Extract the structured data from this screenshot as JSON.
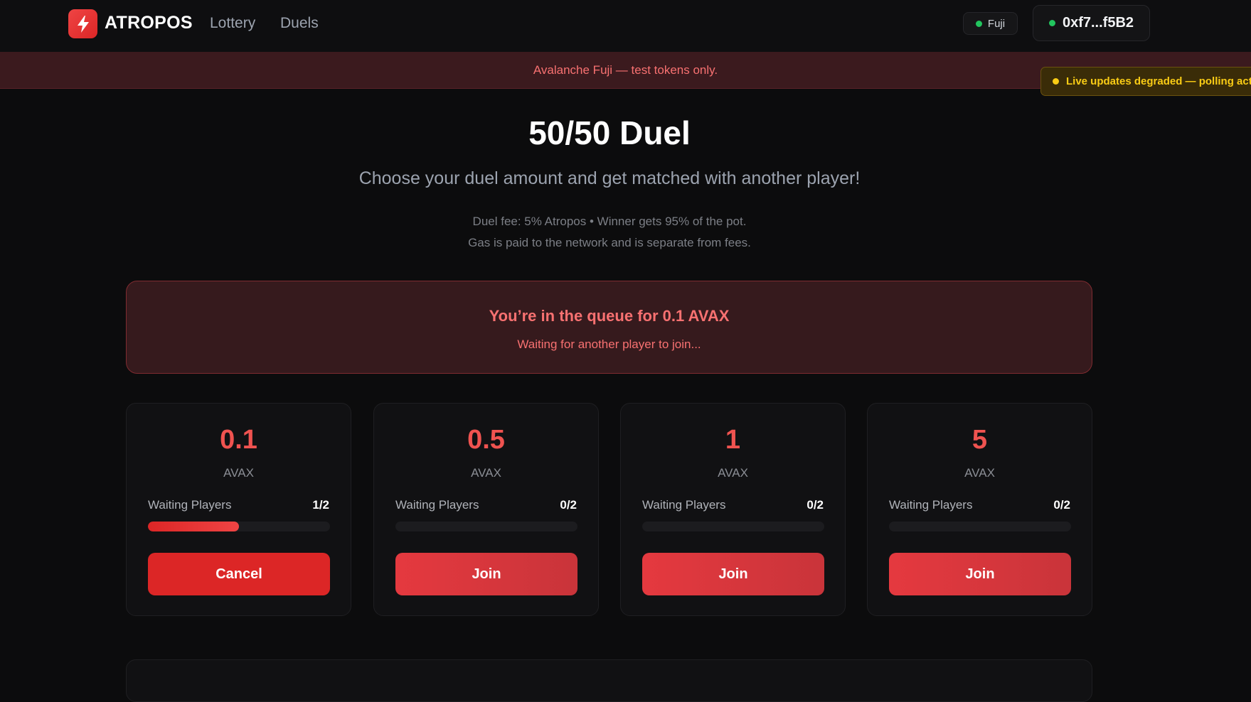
{
  "header": {
    "brand": "ATROPOS",
    "nav": [
      {
        "label": "Lottery"
      },
      {
        "label": "Duels"
      }
    ],
    "network": "Fuji",
    "wallet": "0xf7...f5B2"
  },
  "banner": {
    "text": "Avalanche Fuji — test tokens only."
  },
  "toast": {
    "text": "Live updates degraded — polling act"
  },
  "hero": {
    "title": "50/50 Duel",
    "subtitle": "Choose your duel amount and get matched with another player!",
    "fee_line1": "Duel fee: 5% Atropos • Winner gets 95% of the pot.",
    "fee_line2": "Gas is paid to the network and is separate from fees."
  },
  "queue": {
    "title": "You’re in the queue for 0.1 AVAX",
    "subtitle": "Waiting for another player to join..."
  },
  "cards": [
    {
      "amount": "0.1",
      "currency": "AVAX",
      "waiting_label": "Waiting Players",
      "count": "1/2",
      "fill_fraction": 0.5,
      "button": "Cancel"
    },
    {
      "amount": "0.5",
      "currency": "AVAX",
      "waiting_label": "Waiting Players",
      "count": "0/2",
      "fill_fraction": 0,
      "button": "Join"
    },
    {
      "amount": "1",
      "currency": "AVAX",
      "waiting_label": "Waiting Players",
      "count": "0/2",
      "fill_fraction": 0,
      "button": "Join"
    },
    {
      "amount": "5",
      "currency": "AVAX",
      "waiting_label": "Waiting Players",
      "count": "0/2",
      "fill_fraction": 0,
      "button": "Join"
    }
  ],
  "colors": {
    "accent": "#ef4444",
    "status_online": "#22c55e",
    "warning": "#facc15"
  },
  "icons": {
    "logo": "lightning-bolt-icon",
    "network_status": "status-dot-icon",
    "toast": "warning-dot-icon"
  }
}
